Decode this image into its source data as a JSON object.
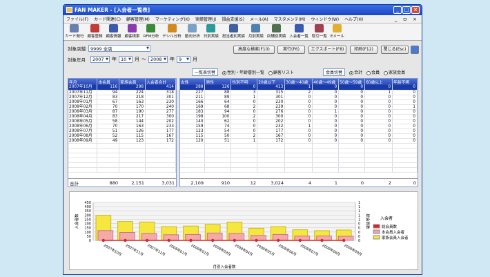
{
  "window": {
    "title": "FAN MAKER - [入会者一覧表]",
    "min": "_",
    "max": "□",
    "close": "×"
  },
  "menu": [
    "ファイル(F)",
    "カード関連(C)",
    "顧客管理(M)",
    "マーケティング(K)",
    "実績管理(J)",
    "損益支援(S)",
    "メール(A)",
    "マスタメンテ(M)",
    "ウィンドウ(W)",
    "ヘルプ(H)"
  ],
  "menu_mdi": "_ ㅁ ×",
  "toolbar": [
    {
      "label": "カード発行",
      "color": "#6a7fb0"
    },
    {
      "label": "顧客登録",
      "color": "#c03a3a"
    },
    {
      "label": "顧客情報",
      "color": "#3a5ab0"
    },
    {
      "label": "顧客検索",
      "color": "#8a3ab0"
    },
    {
      "label": "RFM分析",
      "color": "#3a8a3a"
    },
    {
      "label": "デシル分析",
      "color": "#d08a20"
    },
    {
      "label": "動向分析",
      "color": "#7aa0c8"
    },
    {
      "label": "日別実績",
      "color": "#2a9a9a"
    },
    {
      "label": "担当者別実績",
      "color": "#4060a0"
    },
    {
      "label": "月別実績",
      "color": "#5080b0"
    },
    {
      "label": "店舗別実績",
      "color": "#507050"
    },
    {
      "label": "入会者一覧",
      "color": "#3a5ab0"
    },
    {
      "label": "取引一覧",
      "color": "#a04050"
    },
    {
      "label": "Eメール",
      "color": "#e0b030"
    }
  ],
  "filters": {
    "store_label": "対象店舗",
    "store_value": "9999 全店",
    "ym_label": "対象年月",
    "from_year": "2007",
    "year_unit": "年",
    "from_month": "10",
    "month_unit": "月",
    "tilde": "～",
    "to_year": "2008",
    "to_month": "9"
  },
  "buttons": {
    "advanced_search": "高度な検索(F10)",
    "run": "実行(F6)",
    "export": "エクスポート(F8)",
    "print": "印刷(F12)",
    "close": "閉じる(Esc)"
  },
  "list_switch": {
    "label": "一覧表切替",
    "opt1": "性別・年齢層別一覧",
    "opt2": "顧客リスト"
  },
  "member_switch": {
    "label": "会員切替",
    "opt1": "合計",
    "opt2": "会員",
    "opt3": "家族会員"
  },
  "left_grid": {
    "headers": [
      "年月",
      "本会員",
      "家族会員",
      "入会者合計"
    ],
    "rows": [
      [
        "2007年10月",
        "116",
        "298",
        "414"
      ],
      [
        "2007年11月",
        "94",
        "224",
        "318"
      ],
      [
        "2007年12月",
        "83",
        "218",
        "301"
      ],
      [
        "2008年01月",
        "67",
        "163",
        "230"
      ],
      [
        "2008年02月",
        "70",
        "170",
        "240"
      ],
      [
        "2008年03月",
        "87",
        "190",
        "277"
      ],
      [
        "2008年04月",
        "83",
        "217",
        "300"
      ],
      [
        "2008年05月",
        "58",
        "144",
        "202"
      ],
      [
        "2008年06月",
        "70",
        "163",
        "233"
      ],
      [
        "2008年07月",
        "51",
        "126",
        "177"
      ],
      [
        "2008年08月",
        "52",
        "115",
        "167"
      ],
      [
        "2008年09月",
        "49",
        "123",
        "172"
      ]
    ],
    "total": [
      "合計",
      "880",
      "2,151",
      "3,031"
    ]
  },
  "right_grid": {
    "headers": [
      "女性",
      "男性",
      "性別不明",
      "20歳以下",
      "30歳～40歳",
      "40歳～49歳",
      "50歳～59歳",
      "60歳以上",
      "年齢不明"
    ],
    "rows": [
      [
        "288",
        "126",
        "0",
        "413",
        "1",
        "0",
        "0",
        "0",
        "0"
      ],
      [
        "227",
        "88",
        "3",
        "315",
        "2",
        "0",
        "0",
        "1",
        "0"
      ],
      [
        "211",
        "89",
        "1",
        "301",
        "0",
        "0",
        "0",
        "0",
        "0"
      ],
      [
        "166",
        "64",
        "0",
        "230",
        "0",
        "0",
        "0",
        "0",
        "0"
      ],
      [
        "169",
        "68",
        "2",
        "239",
        "0",
        "0",
        "0",
        "0",
        "1"
      ],
      [
        "183",
        "94",
        "0",
        "276",
        "0",
        "1",
        "0",
        "0",
        "0"
      ],
      [
        "198",
        "100",
        "2",
        "300",
        "0",
        "0",
        "0",
        "0",
        "0"
      ],
      [
        "140",
        "62",
        "0",
        "202",
        "0",
        "0",
        "0",
        "0",
        "0"
      ],
      [
        "159",
        "74",
        "0",
        "232",
        "1",
        "0",
        "0",
        "0",
        "0"
      ],
      [
        "123",
        "54",
        "0",
        "177",
        "0",
        "0",
        "0",
        "0",
        "0"
      ],
      [
        "115",
        "50",
        "2",
        "167",
        "0",
        "0",
        "0",
        "0",
        "0"
      ],
      [
        "120",
        "51",
        "1",
        "172",
        "0",
        "0",
        "0",
        "0",
        "0"
      ]
    ],
    "total": [
      "2,109",
      "910",
      "12",
      "3,024",
      "4",
      "1",
      "0",
      "2",
      "0"
    ]
  },
  "chart_data": {
    "type": "bar",
    "categories": [
      "2007年10月",
      "2007年11月",
      "2007年12月",
      "2008年01月",
      "2008年02月",
      "2008年03月",
      "2008年04月",
      "2008年05月",
      "2008年06月",
      "2008年07月",
      "2008年08月",
      "2008年09月"
    ],
    "xlabel": "月別入会者数",
    "ylabel": "入会者数",
    "y2label": "総会員数",
    "ylim": [
      0,
      450
    ],
    "yticks": [
      "450",
      "400",
      "350",
      "300",
      "250",
      "200",
      "150",
      "100",
      "50",
      "0"
    ],
    "y2ticks": [
      "1",
      "1",
      "1",
      "1",
      "1",
      "0",
      "0",
      "0",
      "0",
      "0"
    ],
    "series": [
      {
        "name": "総会員数",
        "values": [
          0,
          0,
          0,
          0,
          0,
          0,
          0,
          0,
          0,
          0,
          0,
          0
        ],
        "color": "#e0202a"
      },
      {
        "name": "本会員入会者",
        "values": [
          116,
          94,
          83,
          67,
          70,
          87,
          83,
          58,
          70,
          51,
          52,
          49
        ],
        "color": "#f2a0b8"
      },
      {
        "name": "家族会員入会者",
        "values": [
          298,
          224,
          218,
          163,
          170,
          190,
          217,
          144,
          163,
          126,
          115,
          123
        ],
        "color": "#f5e640"
      }
    ],
    "legend_title": "入会者",
    "legend": "right"
  }
}
